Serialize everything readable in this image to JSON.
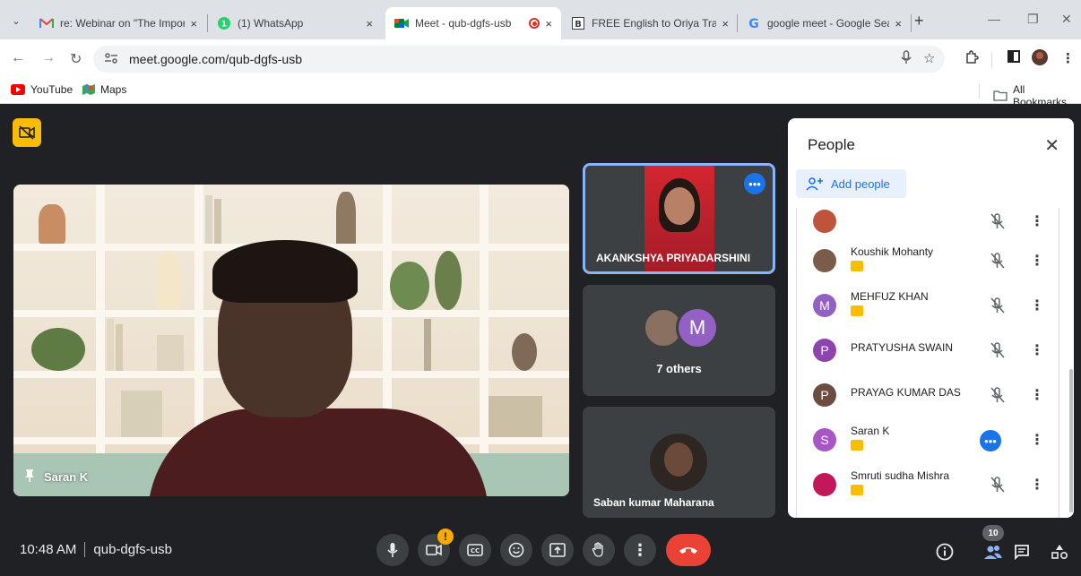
{
  "browser": {
    "tabs": [
      {
        "title": "re: Webinar on \"The Import",
        "icon": "gmail-icon",
        "active": false
      },
      {
        "title": "(1) WhatsApp",
        "icon": "whatsapp-icon",
        "active": false
      },
      {
        "title": "Meet - qub-dgfs-usb",
        "icon": "google-meet-icon",
        "active": true,
        "recording": true
      },
      {
        "title": "FREE English to Oriya Transl",
        "icon": "translate-icon",
        "active": false
      },
      {
        "title": "google meet - Google Sear",
        "icon": "google-icon",
        "active": false
      }
    ],
    "close_glyph": "×",
    "new_tab_glyph": "+",
    "url": "meet.google.com/qub-dgfs-usb",
    "bookmarks": [
      {
        "label": "YouTube",
        "icon": "youtube-icon"
      },
      {
        "label": "Maps",
        "icon": "maps-icon"
      }
    ],
    "all_bookmarks_label": "All Bookmarks"
  },
  "meet": {
    "main_tile": {
      "name": "Saran K"
    },
    "tiles": [
      {
        "name": "AKANKSHYA PRIYADARSHINI",
        "active_speaker": true
      },
      {
        "others_label": "7 others",
        "avatar_letter": "M"
      },
      {
        "name": "Saban kumar Maharana"
      }
    ],
    "people_panel": {
      "title": "People",
      "add_people_label": "Add people",
      "participants": [
        {
          "name": "",
          "avatar_type": "photo",
          "avatar_color": "#c0533b",
          "muted": true,
          "partial": true
        },
        {
          "name": "Koushik Mohanty",
          "avatar_type": "photo",
          "avatar_color": "#7a5c4a",
          "muted": true,
          "badge": true
        },
        {
          "name": "MEHFUZ KHAN",
          "avatar_type": "letter",
          "letter": "M",
          "avatar_color": "#9360c3",
          "muted": true,
          "badge": true
        },
        {
          "name": "PRATYUSHA SWAIN",
          "avatar_type": "letter",
          "letter": "P",
          "avatar_color": "#8e44ad",
          "muted": true,
          "badge": false
        },
        {
          "name": "PRAYAG KUMAR DAS",
          "avatar_type": "letter",
          "letter": "P",
          "avatar_color": "#6d4c41",
          "muted": true,
          "badge": false
        },
        {
          "name": "Saran K",
          "avatar_type": "letter",
          "letter": "S",
          "avatar_color": "#a855c8",
          "muted": false,
          "speaking": true,
          "badge": true
        },
        {
          "name": "Smruti sudha Mishra",
          "avatar_type": "photo",
          "avatar_color": "#c2185b",
          "muted": true,
          "badge": true
        }
      ]
    },
    "bottom_bar": {
      "time": "10:48 AM",
      "meeting_code": "qub-dgfs-usb",
      "camera_alert": "!",
      "participant_count": "10"
    }
  },
  "colors": {
    "meet_bg": "#202124",
    "hangup_red": "#ea4335",
    "accent_blue": "#1a73e8",
    "speaker_outline": "#8ab4f8",
    "badge_yellow": "#fbbc04"
  }
}
